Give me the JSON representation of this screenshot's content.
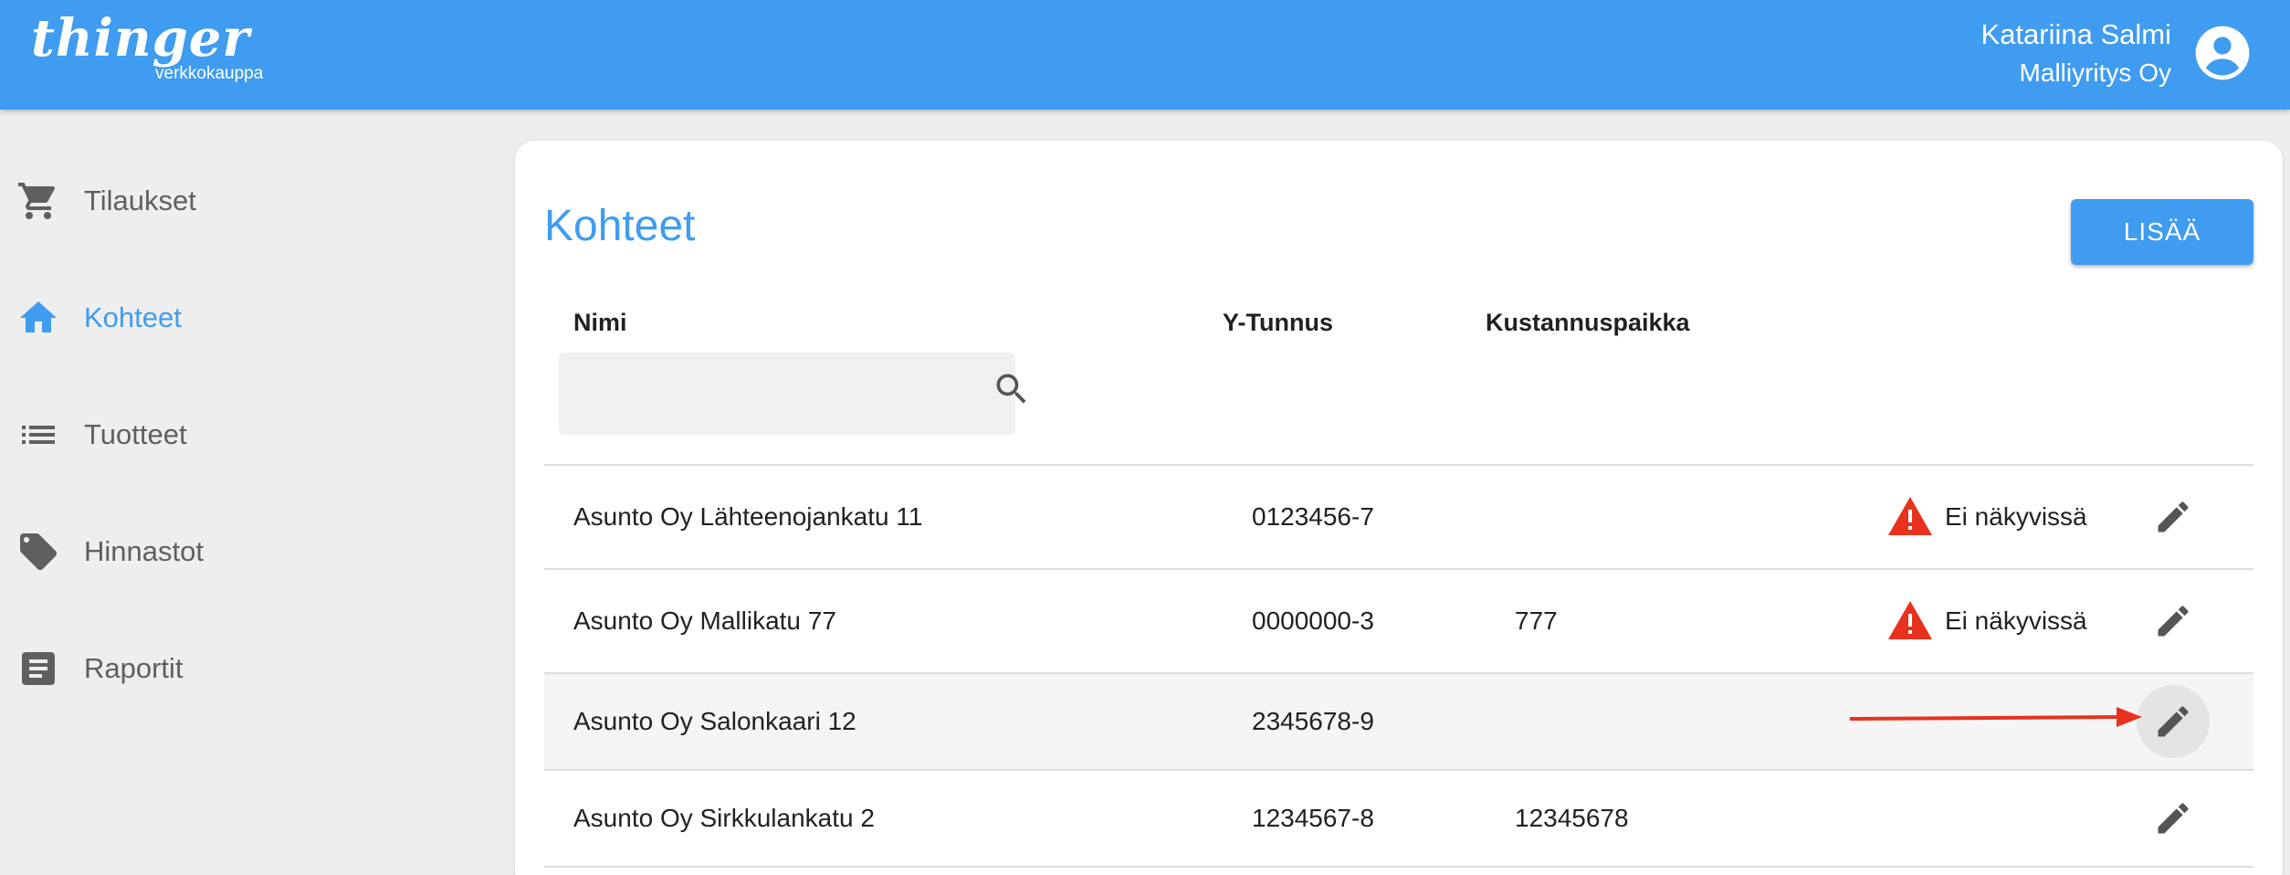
{
  "header": {
    "logo_text": "thinger",
    "logo_subtext": "verkkokauppa",
    "user_name": "Katariina Salmi",
    "company": "Malliyritys Oy",
    "account_icon": "account-circle-icon",
    "color": "#3f9cf0"
  },
  "sidebar": {
    "items": [
      {
        "label": "Tilaukset",
        "icon": "cart-icon",
        "active": false
      },
      {
        "label": "Kohteet",
        "icon": "home-icon",
        "active": true
      },
      {
        "label": "Tuotteet",
        "icon": "list-icon",
        "active": false
      },
      {
        "label": "Hinnastot",
        "icon": "tag-icon",
        "active": false
      },
      {
        "label": "Raportit",
        "icon": "report-icon",
        "active": false
      }
    ]
  },
  "main": {
    "title": "Kohteet",
    "add_button": "LISÄÄ",
    "columns": [
      "Nimi",
      "Y-Tunnus",
      "Kustannuspaikka"
    ],
    "search": {
      "value": "",
      "placeholder": ""
    },
    "rows": [
      {
        "name": "Asunto Oy Lähteenojankatu 11",
        "ytunnus": "0123456-7",
        "kustannuspaikka": "",
        "status": "Ei näkyvissä"
      },
      {
        "name": "Asunto Oy Mallikatu 77",
        "ytunnus": "0000000-3",
        "kustannuspaikka": "777",
        "status": "Ei näkyvissä"
      },
      {
        "name": "Asunto Oy Salonkaari 12",
        "ytunnus": "2345678-9",
        "kustannuspaikka": "",
        "status": ""
      },
      {
        "name": "Asunto Oy Sirkkulankatu 2",
        "ytunnus": "1234567-8",
        "kustannuspaikka": "12345678",
        "status": ""
      }
    ]
  },
  "colors": {
    "accent": "#3f9cf0",
    "warning": "#e8321e",
    "annotation_arrow": "#e8321e"
  }
}
